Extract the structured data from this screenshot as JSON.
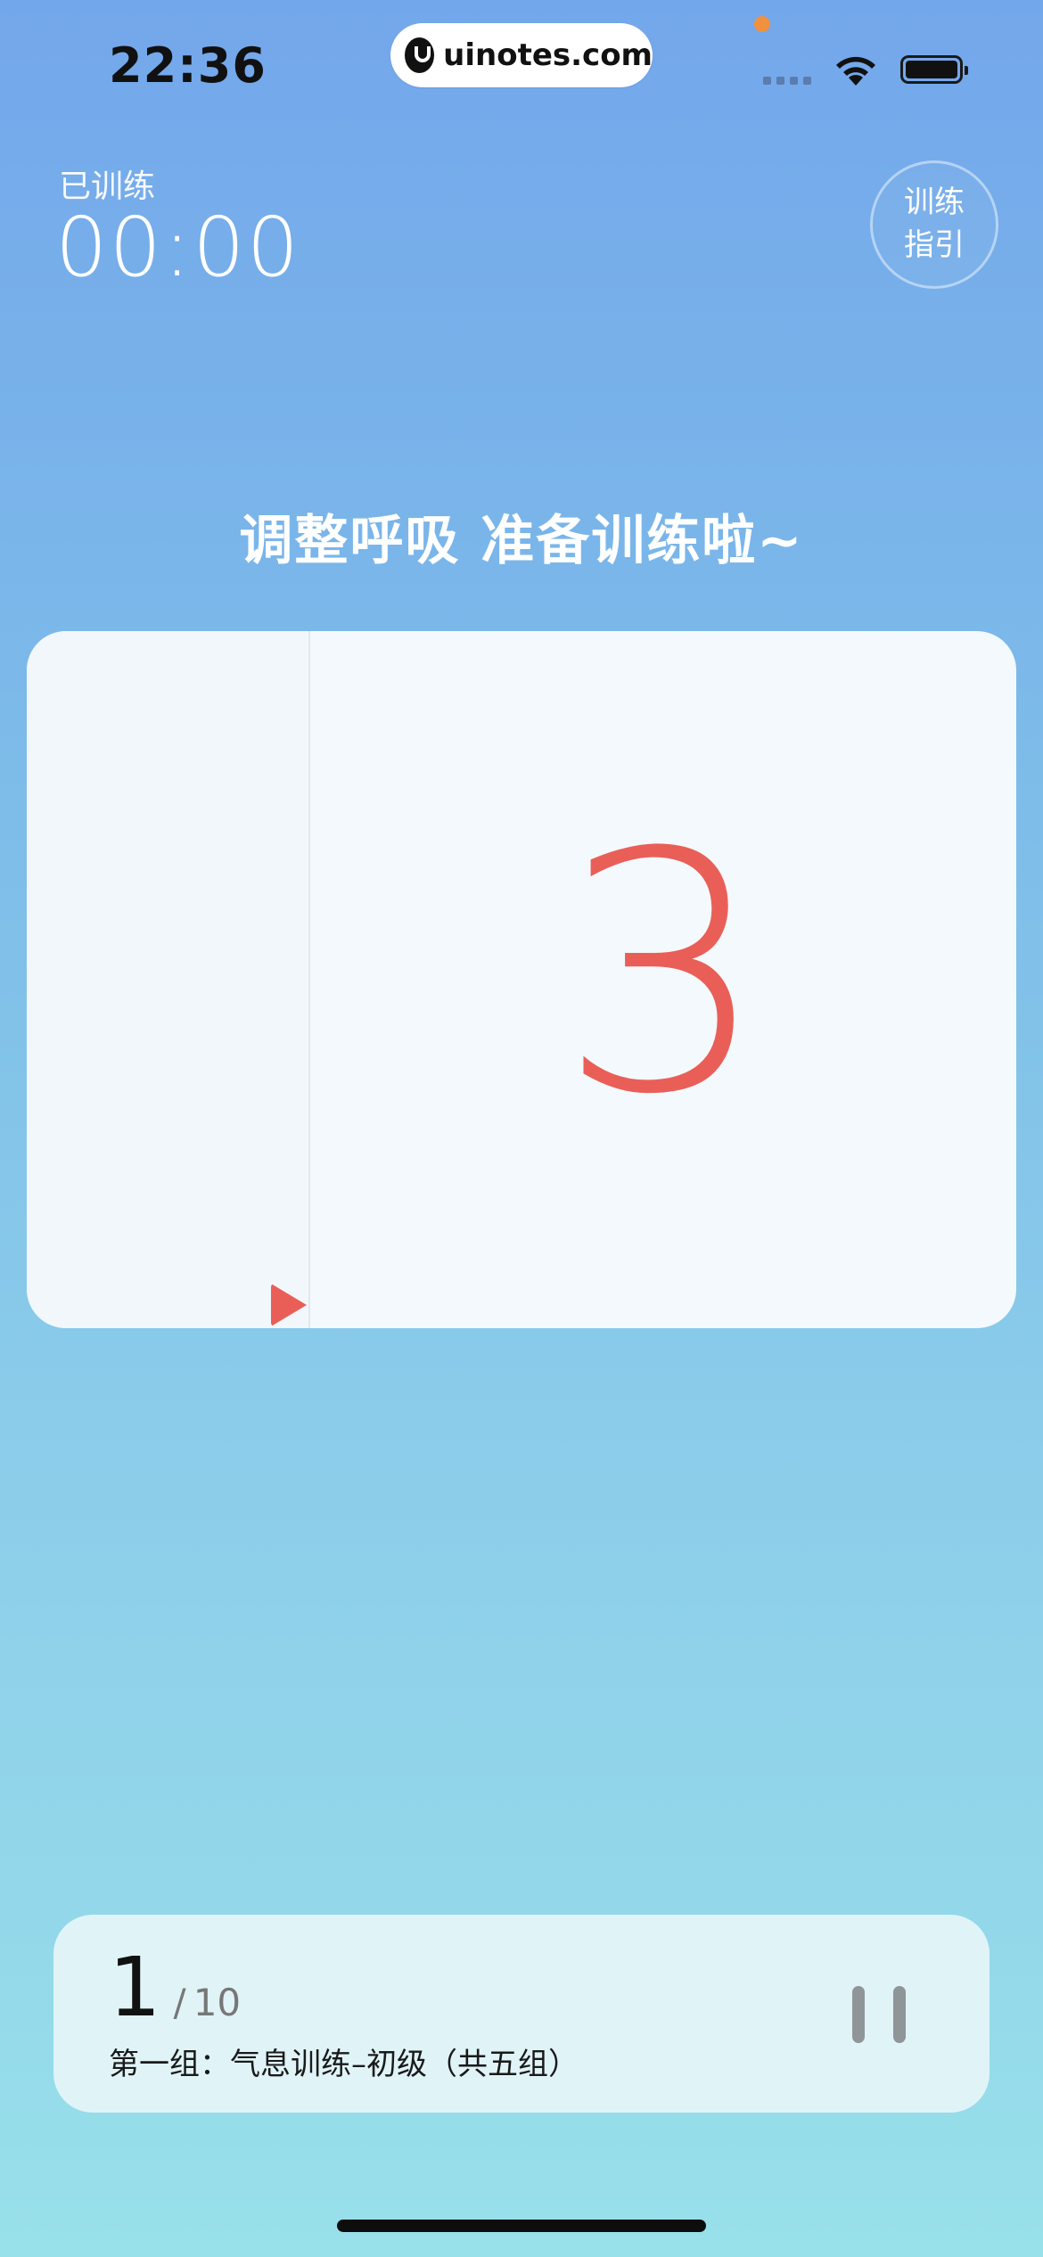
{
  "status_bar": {
    "time": "22:36",
    "url": "uinotes.com",
    "icons": [
      "signal-icon",
      "wifi-icon",
      "battery-icon"
    ]
  },
  "training": {
    "elapsed_label": "已训练",
    "elapsed_time": "00:00",
    "guide_line1": "训练",
    "guide_line2": "指引",
    "prompt": "调整呼吸 准备训练啦~",
    "countdown": "3"
  },
  "progress": {
    "current": "1",
    "separator": "/",
    "total": "10",
    "group_description": "第一组：气息训练–初级（共五组）"
  },
  "colors": {
    "countdown": "#e95f58",
    "card_background": "#f4f9fd",
    "panel_background": "#e0f4f8"
  }
}
